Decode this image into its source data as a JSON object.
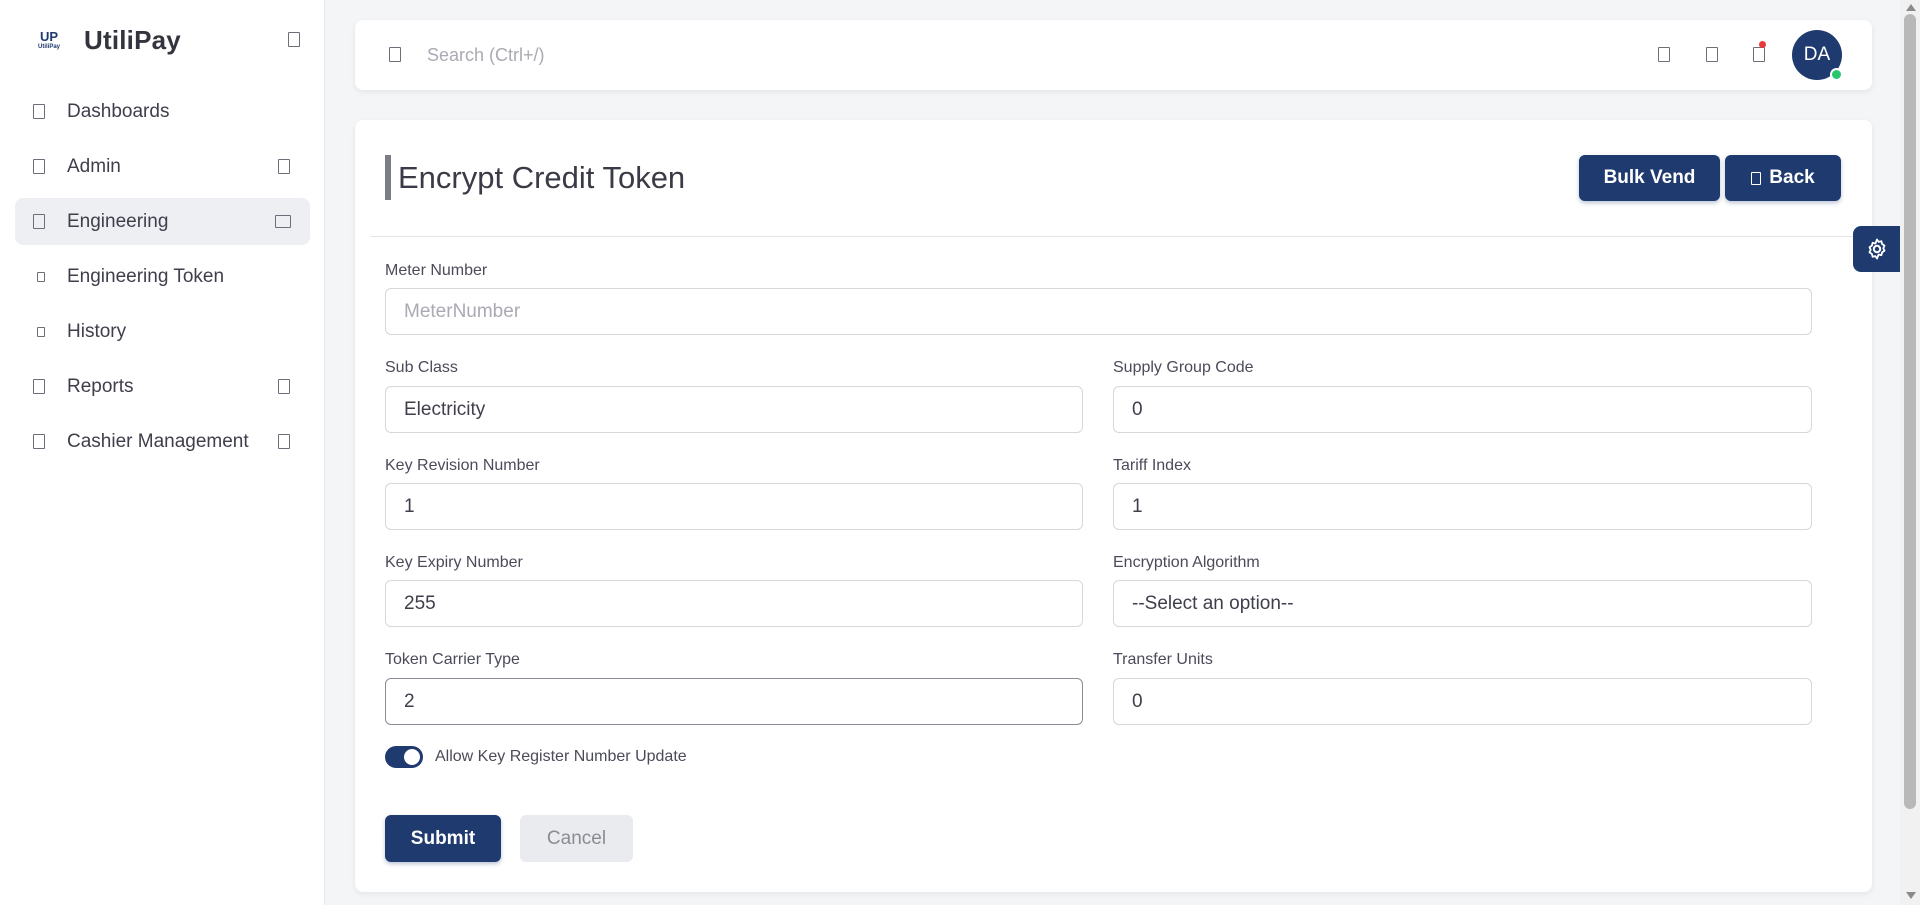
{
  "app": {
    "logo_text": "UP",
    "logo_subtext": "UtiliPay",
    "name": "UtiliPay"
  },
  "sidebar": {
    "items": [
      {
        "label": "Dashboards",
        "icon": "dashboard-icon",
        "has_chevron": false
      },
      {
        "label": "Admin",
        "icon": "admin-icon",
        "has_chevron": true
      },
      {
        "label": "Engineering",
        "icon": "engineering-icon",
        "has_chevron": true,
        "active": true
      },
      {
        "label": "Engineering Token",
        "icon": "bullet-icon",
        "sub": true
      },
      {
        "label": "History",
        "icon": "bullet-icon",
        "sub": true
      },
      {
        "label": "Reports",
        "icon": "reports-icon",
        "has_chevron": true
      },
      {
        "label": "Cashier Management",
        "icon": "cashier-icon",
        "has_chevron": true
      }
    ]
  },
  "topbar": {
    "search_placeholder": "Search (Ctrl+/)",
    "avatar_initials": "DA"
  },
  "page": {
    "title": "Encrypt Credit Token",
    "bulk_vend_label": "Bulk Vend",
    "back_label": "Back"
  },
  "form": {
    "meter_number": {
      "label": "Meter Number",
      "placeholder": "MeterNumber",
      "value": ""
    },
    "sub_class": {
      "label": "Sub Class",
      "value": "Electricity"
    },
    "supply_group_code": {
      "label": "Supply Group Code",
      "value": "0"
    },
    "key_revision_number": {
      "label": "Key Revision Number",
      "value": "1"
    },
    "tariff_index": {
      "label": "Tariff Index",
      "value": "1"
    },
    "key_expiry_number": {
      "label": "Key Expiry Number",
      "value": "255"
    },
    "encryption_algorithm": {
      "label": "Encryption Algorithm",
      "value": "--Select an option--"
    },
    "token_carrier_type": {
      "label": "Token Carrier Type",
      "value": "2"
    },
    "transfer_units": {
      "label": "Transfer Units",
      "value": "0"
    },
    "allow_krn_update": {
      "label": "Allow Key Register Number Update",
      "checked": true
    },
    "submit_label": "Submit",
    "cancel_label": "Cancel"
  },
  "colors": {
    "primary": "#1f3a6f",
    "notification_dot": "#ea3b3b",
    "online_status": "#28c76f"
  }
}
